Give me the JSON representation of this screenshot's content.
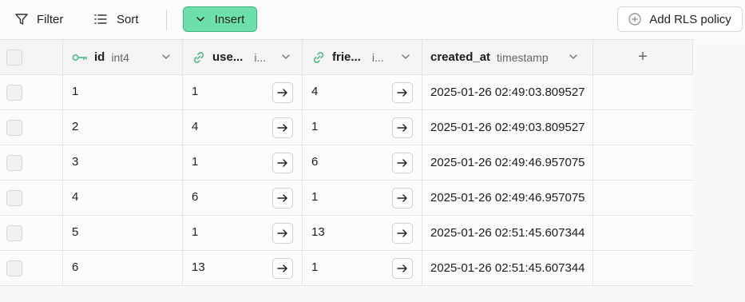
{
  "toolbar": {
    "filter_label": "Filter",
    "sort_label": "Sort",
    "insert_label": "Insert",
    "rls_label": "Add RLS policy"
  },
  "columns": [
    {
      "name": "id",
      "type": "int4",
      "icon": "key-icon"
    },
    {
      "name": "use...",
      "type": "i...",
      "icon": "link-icon"
    },
    {
      "name": "frie...",
      "type": "i...",
      "icon": "link-icon"
    },
    {
      "name": "created_at",
      "type": "timestamp",
      "icon": ""
    }
  ],
  "add_column_label": "+",
  "rows": [
    {
      "id": "1",
      "user": "1",
      "friend": "4",
      "created_at": "2025-01-26 02:49:03.809527"
    },
    {
      "id": "2",
      "user": "4",
      "friend": "1",
      "created_at": "2025-01-26 02:49:03.809527"
    },
    {
      "id": "3",
      "user": "1",
      "friend": "6",
      "created_at": "2025-01-26 02:49:46.957075"
    },
    {
      "id": "4",
      "user": "6",
      "friend": "1",
      "created_at": "2025-01-26 02:49:46.957075"
    },
    {
      "id": "5",
      "user": "1",
      "friend": "13",
      "created_at": "2025-01-26 02:51:45.607344"
    },
    {
      "id": "6",
      "user": "13",
      "friend": "1",
      "created_at": "2025-01-26 02:51:45.607344"
    }
  ],
  "colors": {
    "accent": "#6ce0a8",
    "accent_border": "#3fb47c",
    "link_icon": "#3fb47c"
  }
}
